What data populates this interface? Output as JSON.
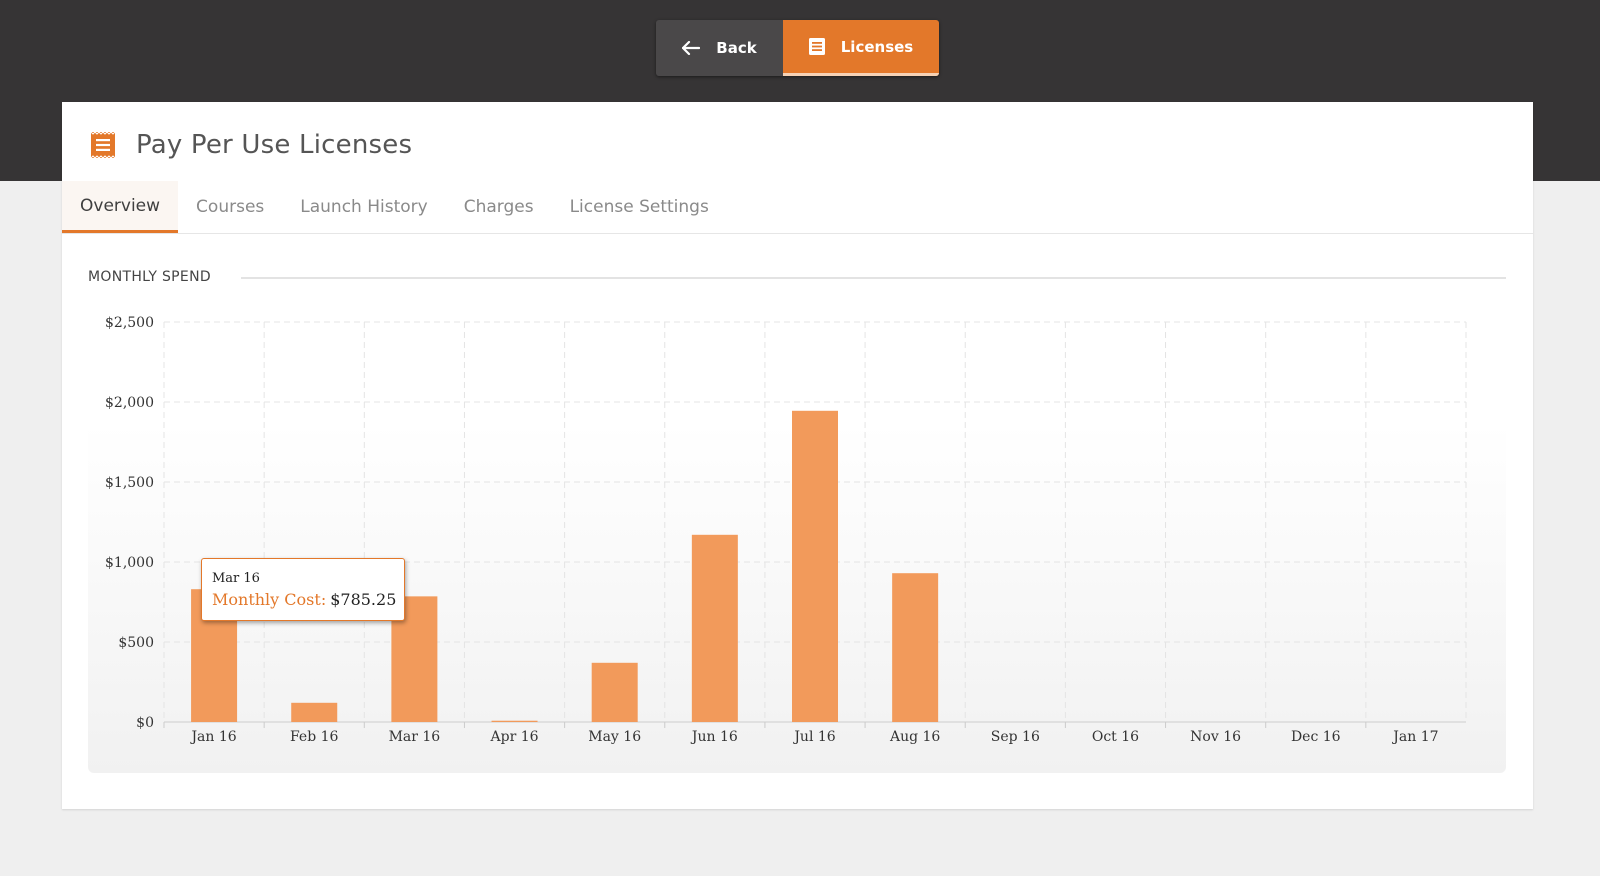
{
  "nav": {
    "back_label": "Back",
    "licenses_label": "Licenses"
  },
  "page": {
    "title": "Pay Per Use Licenses",
    "tabs": [
      {
        "label": "Overview",
        "active": true
      },
      {
        "label": "Courses",
        "active": false
      },
      {
        "label": "Launch History",
        "active": false
      },
      {
        "label": "Charges",
        "active": false
      },
      {
        "label": "License Settings",
        "active": false
      }
    ],
    "section_label": "MONTHLY SPEND"
  },
  "icons": {
    "back": "arrow-left-icon",
    "licenses": "license-document-icon",
    "header": "license-stamp-icon"
  },
  "colors": {
    "accent": "#e3782a",
    "bar": "#f29a5b",
    "dark_band": "#363435"
  },
  "tooltip": {
    "title": "Mar 16",
    "series_label": "Monthly Cost:",
    "value": "$785.25"
  },
  "chart_data": {
    "type": "bar",
    "categories": [
      "Jan 16",
      "Feb 16",
      "Mar 16",
      "Apr 16",
      "May 16",
      "Jun 16",
      "Jul 16",
      "Aug 16",
      "Sep 16",
      "Oct 16",
      "Nov 16",
      "Dec 16",
      "Jan 17"
    ],
    "series": [
      {
        "name": "Monthly Cost",
        "values": [
          830,
          120,
          785.25,
          8,
          370,
          1170,
          1945,
          930,
          0,
          0,
          0,
          0,
          0
        ]
      }
    ],
    "ylim": [
      0,
      2500
    ],
    "yticks": [
      0,
      500,
      1000,
      1500,
      2000,
      2500
    ],
    "ytick_labels": [
      "$0",
      "$500",
      "$1,000",
      "$1,500",
      "$2,000",
      "$2,500"
    ],
    "grid": true
  }
}
